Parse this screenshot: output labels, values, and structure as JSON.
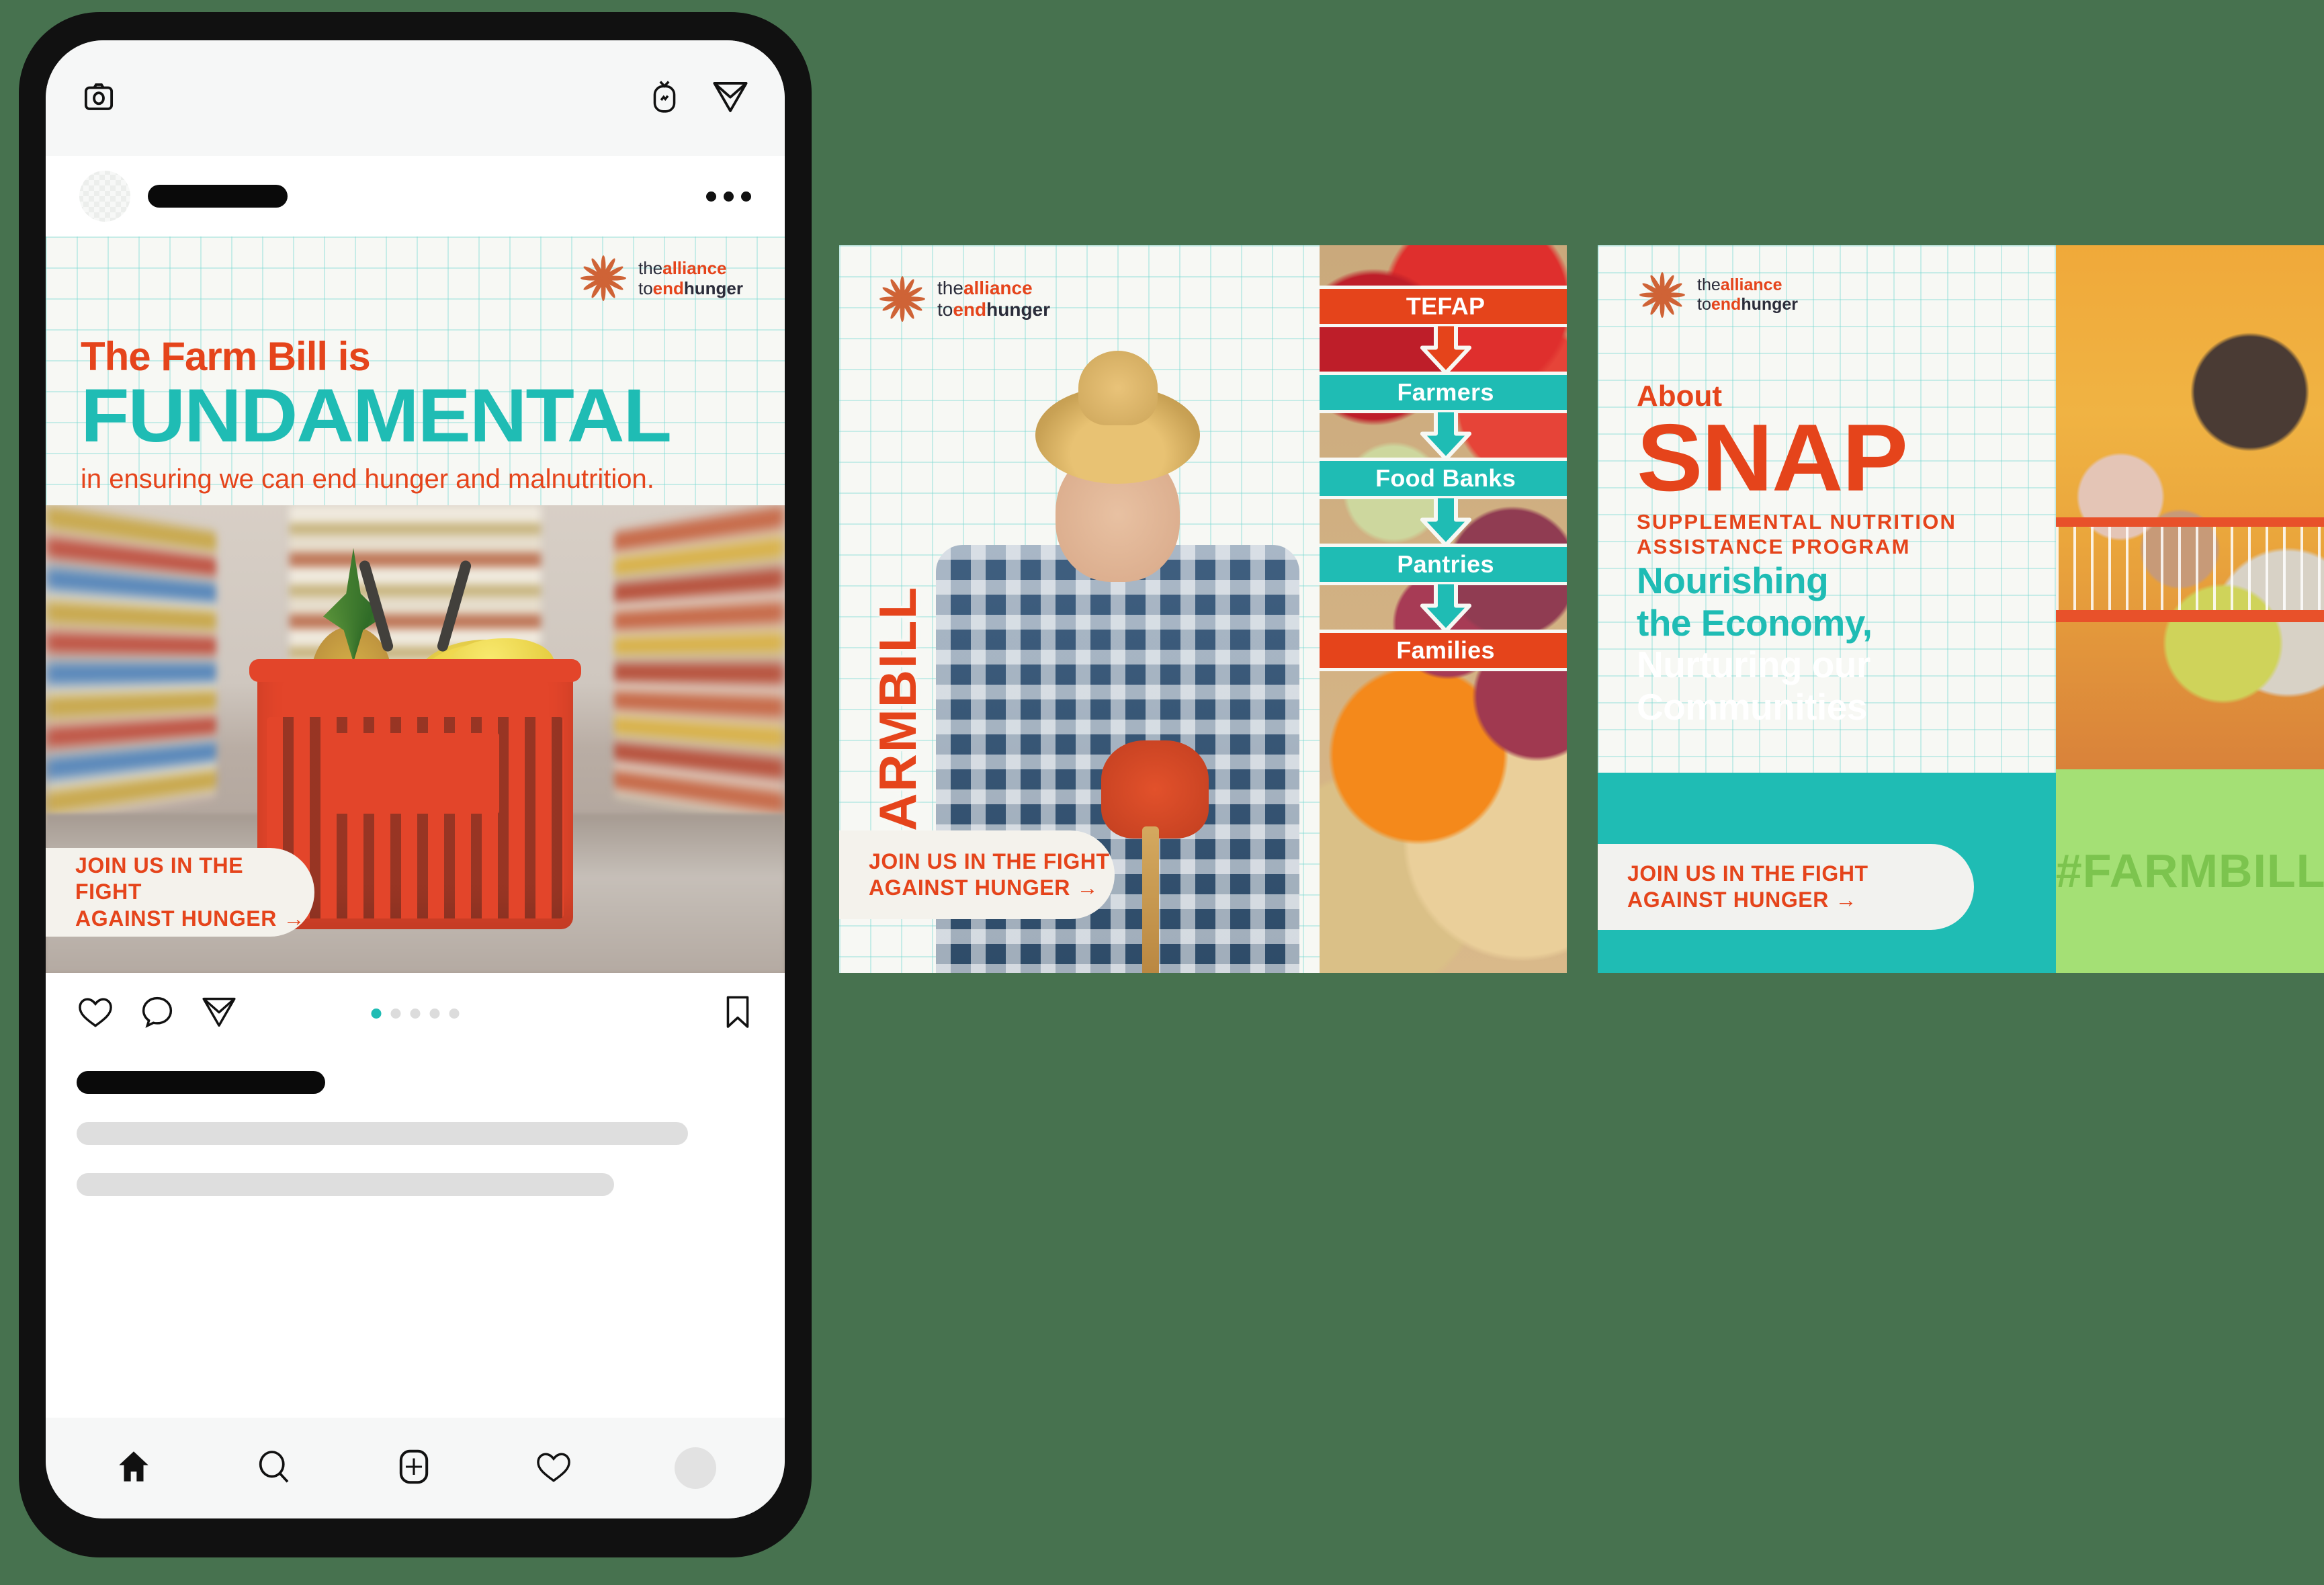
{
  "colors": {
    "background": "#47724f",
    "orange": "#e5441b",
    "teal": "#1fbcb4",
    "green": "#a4e075",
    "paper": "#f7f8f4"
  },
  "phone": {
    "topbar": {
      "camera_icon": "camera-icon",
      "igtv_icon": "igtv-icon",
      "direct_icon": "paper-plane-icon"
    },
    "post_header": {
      "avatar": "avatar",
      "username_redacted": "",
      "more_icon": "more-options-icon"
    },
    "actions": {
      "like_icon": "heart-icon",
      "comment_icon": "comment-icon",
      "share_icon": "paper-plane-icon",
      "bookmark_icon": "bookmark-icon",
      "carousel_dots": 5,
      "carousel_active_index": 0
    },
    "tabbar": {
      "items": [
        {
          "name": "home-icon"
        },
        {
          "name": "search-icon"
        },
        {
          "name": "add-post-icon"
        },
        {
          "name": "activity-heart-icon"
        },
        {
          "name": "profile-avatar"
        }
      ]
    }
  },
  "brand": {
    "logo_line1_a": "the",
    "logo_line1_b": "alliance",
    "logo_line2_a": "to",
    "logo_line2_b": "end",
    "logo_line2_c": "hunger",
    "mark": "sunburst-logo-icon"
  },
  "cta": {
    "label": "JOIN US IN THE FIGHT\nAGAINST HUNGER →"
  },
  "card1": {
    "kicker": "The Farm Bill is",
    "headline": "FUNDAMENTAL",
    "subline": "in ensuring we can end hunger and malnutrition.",
    "photo_alt": "grocery-basket-photo"
  },
  "card2": {
    "hashtag": "#FARMBILL",
    "photo_alt": "farmer-portrait-photo",
    "food_photo_alt": "fresh-produce-photo",
    "flow": [
      {
        "label": "TEFAP",
        "color": "orange"
      },
      {
        "label": "Farmers",
        "color": "teal"
      },
      {
        "label": "Food Banks",
        "color": "teal"
      },
      {
        "label": "Pantries",
        "color": "teal"
      },
      {
        "label": "Families",
        "color": "orange"
      }
    ]
  },
  "card3": {
    "about": "About",
    "title": "SNAP",
    "subtitle": "SUPPLEMENTAL NUTRITION\nASSISTANCE PROGRAM",
    "tagline": "Nourishing\nthe Economy,\nNurturing our\nCommunities",
    "hashtag": "#FARMBILL",
    "photo_alt": "family-grocery-shopping-photo"
  }
}
